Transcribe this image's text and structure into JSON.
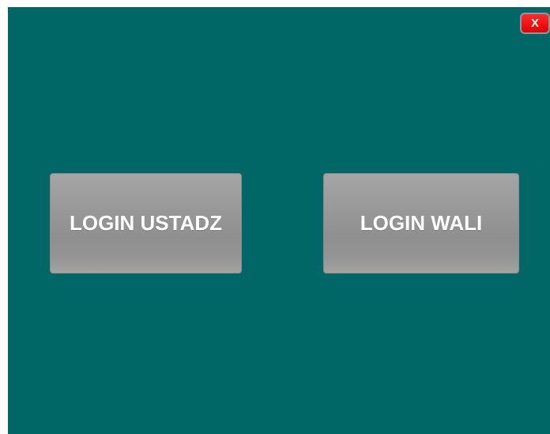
{
  "window": {
    "background_color": "#006666"
  },
  "close_button": {
    "label": "X",
    "color": "#ff1a1a"
  },
  "buttons": {
    "login_ustadz": "LOGIN USTADZ",
    "login_wali": "LOGIN WALI"
  }
}
